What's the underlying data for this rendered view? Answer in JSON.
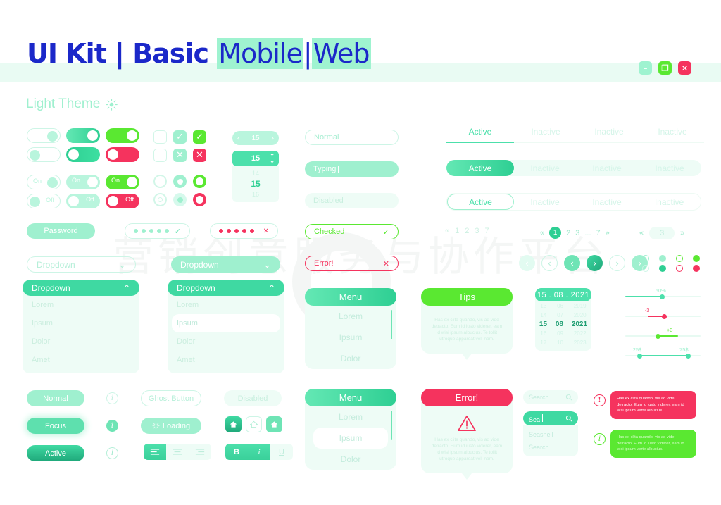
{
  "header": {
    "title_bold": "UI Kit | Basic",
    "title_light_1": "Mobile",
    "title_sep": "|",
    "title_light_2": "Web",
    "theme_label": "Light Theme",
    "sun_icon": "sun-icon",
    "window_buttons": [
      {
        "name": "minimize",
        "glyph": "–",
        "color": "#9ff3d0"
      },
      {
        "name": "maximize",
        "glyph": "❐",
        "color": "#5ae831"
      },
      {
        "name": "close",
        "glyph": "✕",
        "color": "#f5335e"
      }
    ]
  },
  "toggles": {
    "row1": [
      {
        "state": "on",
        "style": "outline"
      },
      {
        "state": "on",
        "style": "mint-gradient"
      },
      {
        "state": "on",
        "style": "green"
      }
    ],
    "row2": [
      {
        "state": "off",
        "style": "outline"
      },
      {
        "state": "off",
        "style": "mint-gradient"
      },
      {
        "state": "off",
        "style": "red"
      }
    ],
    "labeled": [
      {
        "label": "On",
        "style": "pale"
      },
      {
        "label": "On",
        "style": "pale2"
      },
      {
        "label": "On",
        "style": "green"
      },
      {
        "label": "Off",
        "style": "pale"
      },
      {
        "label": "Off",
        "style": "pale2"
      },
      {
        "label": "Off",
        "style": "red"
      }
    ]
  },
  "checkboxes": {
    "check_glyph": "✓",
    "cross_glyph": "✕",
    "items": [
      {
        "state": "empty",
        "color": "#ffffff"
      },
      {
        "state": "checked",
        "color": "#9ff0cf"
      },
      {
        "state": "checked",
        "color": "#5ae831"
      },
      {
        "state": "empty",
        "color": "#ffffff"
      },
      {
        "state": "crossed",
        "color": "#9ff0cf"
      },
      {
        "state": "crossed",
        "color": "#f5335e"
      }
    ]
  },
  "radios": [
    {
      "state": "empty",
      "color": "#d2f6e8"
    },
    {
      "state": "filled",
      "color": "#9ff0cf"
    },
    {
      "state": "ring",
      "color": "#5ae831"
    },
    {
      "state": "dot",
      "color": "#d2f6e8"
    },
    {
      "state": "dot",
      "color": "#9ff0cf"
    },
    {
      "state": "ring",
      "color": "#f5335e"
    }
  ],
  "stepper": {
    "compact_value": "15",
    "prev_glyph": "‹",
    "next_glyph": "›",
    "spin_value": "15",
    "spin_up": "⌃",
    "spin_down": "⌄",
    "list": [
      "14",
      "15",
      "16"
    ],
    "selected": "15"
  },
  "inputs": [
    {
      "label": "Normal",
      "state": "normal"
    },
    {
      "label": "Typing",
      "state": "typing"
    },
    {
      "label": "Disabled",
      "state": "disabled"
    }
  ],
  "tabs": {
    "underline": [
      "Active",
      "Inactive",
      "Inactive",
      "Inactive"
    ],
    "pill_filled": [
      "Active",
      "Inactive",
      "Inactive",
      "Inactive"
    ],
    "pill_outline": [
      "Active",
      "Inactive",
      "Inactive",
      "Inactive"
    ]
  },
  "password": {
    "label": "Password",
    "valid_glyph": "✓",
    "invalid_glyph": "✕",
    "dot_count": 5
  },
  "validation": [
    {
      "label": "Checked",
      "glyph": "✓",
      "color": "#5ae831"
    },
    {
      "label": "Error!",
      "glyph": "✕",
      "color": "#f5335e"
    }
  ],
  "dropdowns": {
    "collapsed_label": "Dropdown",
    "open_label": "Dropdown",
    "chevron_down": "⌄",
    "chevron_up": "⌃",
    "items": [
      "Lorem",
      "Ipsum",
      "Dolor",
      "Amet"
    ],
    "highlighted": "Ipsum"
  },
  "pagination": {
    "first_glyph": "«",
    "last_glyph": "»",
    "simple_pages": [
      "1",
      "2",
      "3",
      "7"
    ],
    "numbered": [
      "1",
      "2",
      "3",
      "...",
      "7"
    ],
    "current": "1",
    "single_value": "3",
    "arrow_prev": "‹",
    "arrow_next": "›",
    "dots": [
      {
        "style": "outline",
        "color": "#9ff0cf"
      },
      {
        "style": "filled",
        "color": "#9ff0cf"
      },
      {
        "style": "outline",
        "color": "#5ae831"
      },
      {
        "style": "filled",
        "color": "#5ae831"
      },
      {
        "style": "outline",
        "color": "#cdf5e6"
      },
      {
        "style": "filled",
        "color": "#2ecf93"
      },
      {
        "style": "outline",
        "color": "#f5335e"
      },
      {
        "style": "filled",
        "color": "#f5335e"
      }
    ]
  },
  "menu_panel": {
    "title": "Menu",
    "items": [
      "Lorem",
      "Ipsum",
      "Dolor"
    ]
  },
  "menu_panel_bottom": {
    "title": "Menu",
    "items": [
      "Lorem",
      "Ipsum",
      "Dolor"
    ],
    "highlighted": "Ipsum"
  },
  "tips": {
    "title": "Tips",
    "body": "Has ex clita quando, vis ad vide detracto. Eum id iusto viderer, eam id wisi ipsum albucius. Te tollit utroque appareat vel, nam."
  },
  "error_panel": {
    "title": "Error!",
    "warning_icon": "warning-triangle-icon",
    "body": "Has ex clita quando, vis ad vide detracto. Eum id iusto viderer, eam id wisi ipsum albucius. Te tollit utroque appareat vel, nam."
  },
  "datepicker": {
    "selected": "15 . 08 . 2021",
    "rows": [
      [
        "13",
        "06",
        "2019"
      ],
      [
        "14",
        "07",
        "2020"
      ],
      [
        "15",
        "08",
        "2021"
      ],
      [
        "16",
        "09",
        "2022"
      ],
      [
        "17",
        "10",
        "2023"
      ]
    ],
    "selected_index": 2
  },
  "sliders": [
    {
      "label": "50%",
      "color": "#4ce0ab",
      "fill_pct": 50,
      "label_pct": 46,
      "type": "single"
    },
    {
      "label": "-3",
      "color": "#f5335e",
      "fill_pct": 52,
      "start_pct": 30,
      "label_pct": 30,
      "type": "offset"
    },
    {
      "label": "+3",
      "color": "#5ae831",
      "fill_pct": 70,
      "start_pct": 42,
      "label_pct": 54,
      "type": "offset"
    },
    {
      "label_min": "25$",
      "label_max": "75$",
      "color": "#4ce0ab",
      "start_pct": 18,
      "end_pct": 82,
      "type": "range"
    }
  ],
  "buttons": {
    "primary": [
      {
        "label": "Normal",
        "state": "normal"
      },
      {
        "label": "Focus",
        "state": "focus"
      },
      {
        "label": "Active",
        "state": "active"
      }
    ],
    "info_icon": "info-icon",
    "ghost": "Ghost Button",
    "loading": "Loading",
    "loading_icon": "spinner-icon",
    "disabled": "Disabled",
    "home_icon": "home-icon",
    "align_icons": [
      "align-left-icon",
      "align-center-icon",
      "align-right-icon"
    ],
    "format": [
      "B",
      "i",
      "U"
    ]
  },
  "search": {
    "placeholder": "Search",
    "search_icon": "search-icon",
    "typed_value": "Sea",
    "suggestions": [
      "Seashell",
      "Search"
    ]
  },
  "toasts": [
    {
      "type": "error",
      "icon": "alert-circle-icon",
      "color": "#f5335e",
      "text": "Has ex clita quando, vis ad vide detracto. Eum id iusto viderer, eam id wisi ipsum verte albucius."
    },
    {
      "type": "info",
      "icon": "info-circle-icon",
      "color": "#5ae831",
      "text": "Has ex clita quando, vis ad vide detracto. Eum id iusto viderer, eam id wisi ipsum verte albucius."
    }
  ],
  "colors": {
    "brand_blue": "#1b28c9",
    "mint": "#4ce0ab",
    "mint_light": "#9ff0cf",
    "mint_pale": "#eefcf6",
    "green": "#5ae831",
    "red": "#f5335e"
  }
}
